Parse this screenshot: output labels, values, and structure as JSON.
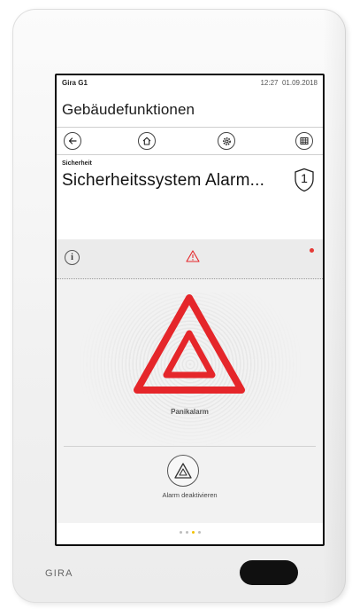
{
  "device": {
    "brand": "GIRA"
  },
  "status_bar": {
    "device_name": "Gira G1",
    "time": "12:27",
    "date": "01.09.2018"
  },
  "header": {
    "title": "Gebäudefunktionen"
  },
  "nav": {
    "icons": [
      "back-arrow-icon",
      "home-icon",
      "settings-icon",
      "grid-icon"
    ]
  },
  "function": {
    "category": "Sicherheit",
    "title": "Sicherheitssystem Alarm...",
    "badge": "1"
  },
  "alarm_panel": {
    "info_label": "i",
    "alarm_name": "Panikalarm",
    "deactivate_label": "Alarm deaktivieren",
    "alert_color": "#e5262a"
  },
  "pager": {
    "total": 4,
    "active": 3
  }
}
